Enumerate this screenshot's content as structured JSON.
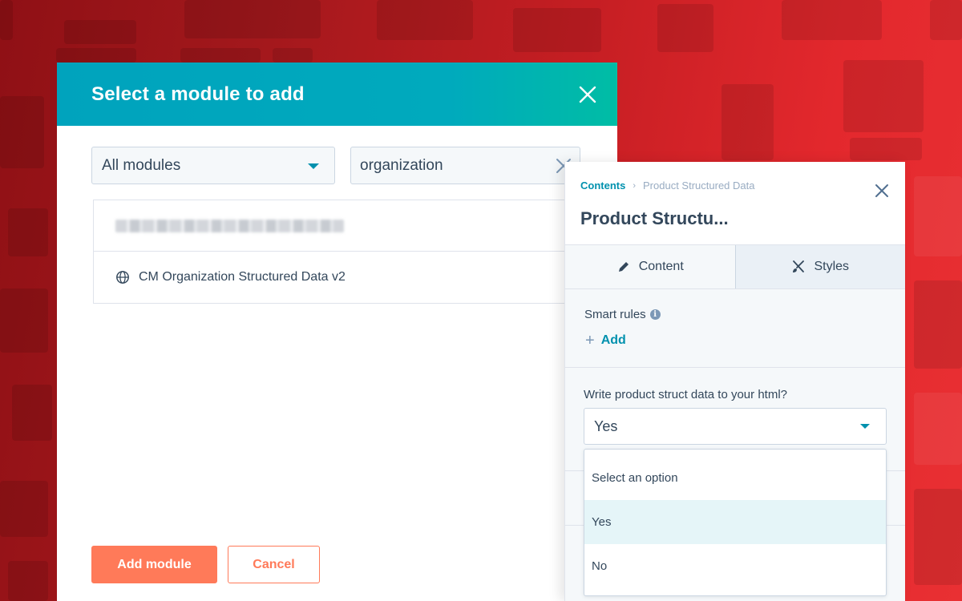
{
  "module_dialog": {
    "title": "Select a module to add",
    "filter": {
      "selected": "All modules"
    },
    "search": {
      "value": "organization"
    },
    "results": [
      {
        "label": "[blurred module name]",
        "blurred": true,
        "icon": "module-icon"
      },
      {
        "label": "CM Organization Structured Data v2",
        "blurred": false,
        "icon": "globe-icon"
      }
    ],
    "buttons": {
      "add": "Add module",
      "cancel": "Cancel"
    }
  },
  "side_panel": {
    "breadcrumb": {
      "parent": "Contents",
      "separator": "›",
      "current": "Product Structured Data"
    },
    "title": "Product Structu...",
    "tabs": [
      {
        "label": "Content",
        "icon": "pencil-icon",
        "active": true
      },
      {
        "label": "Styles",
        "icon": "brush-icon",
        "active": false
      }
    ],
    "smart_rules": {
      "label": "Smart rules",
      "info_icon": "i",
      "add_label": "Add",
      "add_symbol": "+"
    },
    "field": {
      "label": "Write product struct data to your html?",
      "value": "Yes",
      "options": [
        "Select an option",
        "Yes",
        "No"
      ],
      "selected_option": "Yes"
    }
  },
  "colors": {
    "header_teal": "#00a3bd",
    "accent_orange": "#ff7a59",
    "link_teal": "#0091ae",
    "text_dark": "#33475b",
    "background_red": "#c51e23"
  }
}
